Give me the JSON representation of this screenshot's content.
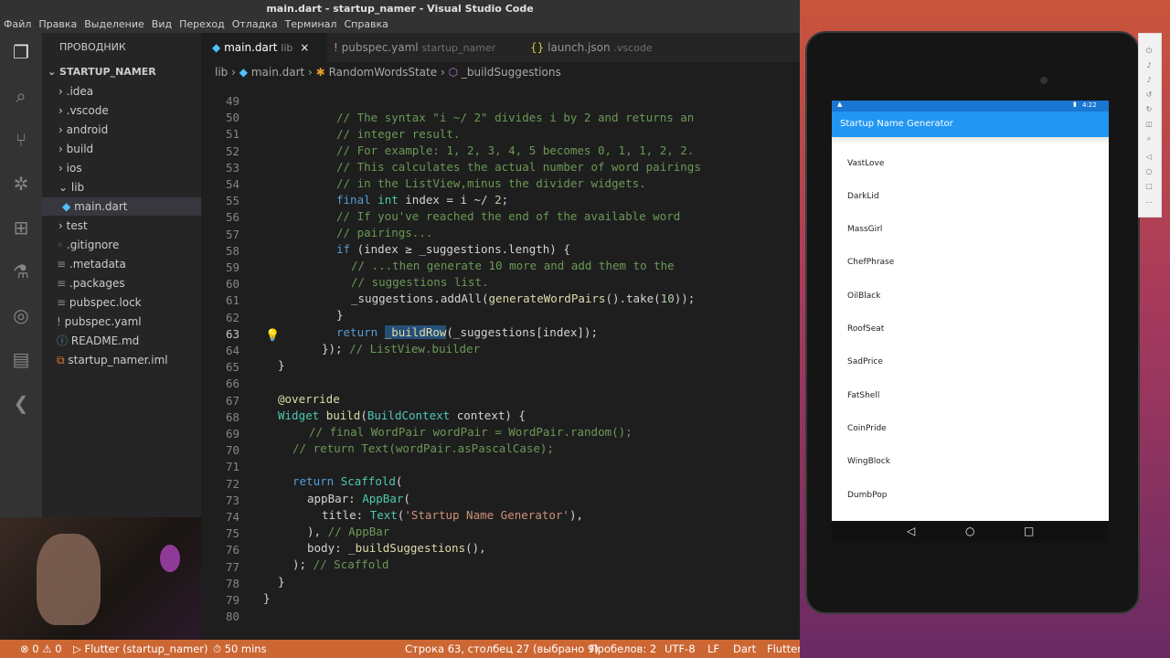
{
  "window": {
    "title": "main.dart - startup_namer - Visual Studio Code"
  },
  "menu": [
    "Файл",
    "Правка",
    "Выделение",
    "Вид",
    "Переход",
    "Отладка",
    "Терминал",
    "Справка"
  ],
  "activity_icons": [
    "explorer-icon",
    "search-icon",
    "source-control-icon",
    "debug-icon",
    "extensions-icon",
    "test-icon",
    "remote-icon",
    "docker-icon",
    "flutter-icon"
  ],
  "sidebar": {
    "header": "ПРОВОДНИК",
    "project": "STARTUP_NAMER",
    "items": [
      {
        "label": ".idea",
        "arrow": "›"
      },
      {
        "label": ".vscode",
        "arrow": "›"
      },
      {
        "label": "android",
        "arrow": "›"
      },
      {
        "label": "build",
        "arrow": "›"
      },
      {
        "label": "ios",
        "arrow": "›"
      },
      {
        "label": "lib",
        "arrow": "⌄"
      },
      {
        "label": "main.dart",
        "arrow": ""
      },
      {
        "label": "test",
        "arrow": "›"
      },
      {
        "label": ".gitignore",
        "arrow": ""
      },
      {
        "label": ".metadata",
        "arrow": ""
      },
      {
        "label": ".packages",
        "arrow": ""
      },
      {
        "label": "pubspec.lock",
        "arrow": ""
      },
      {
        "label": "pubspec.yaml",
        "arrow": ""
      },
      {
        "label": "README.md",
        "arrow": ""
      },
      {
        "label": "startup_namer.iml",
        "arrow": ""
      }
    ]
  },
  "tabs": [
    {
      "name": "main.dart",
      "hint": "lib",
      "close": "×"
    },
    {
      "name": "pubspec.yaml",
      "hint": "startup_namer"
    },
    {
      "name": "launch.json",
      "hint": ".vscode"
    }
  ],
  "breadcrumb": [
    "lib",
    "main.dart",
    "RandomWordsState",
    "_buildSuggestions"
  ],
  "code": {
    "line_numbers": [
      "49",
      "50",
      "51",
      "52",
      "53",
      "54",
      "55",
      "56",
      "57",
      "58",
      "59",
      "60",
      "61",
      "62",
      "63",
      "64",
      "65",
      "66",
      "67",
      "68",
      "69",
      "70",
      "71",
      "72",
      "73",
      "74",
      "75",
      "76",
      "77",
      "78",
      "79",
      "80"
    ],
    "l50": "// The syntax \"i ~/ 2\" divides i by 2 and returns an",
    "l51": "// integer result.",
    "l52": "// For example: 1, 2, 3, 4, 5 becomes 0, 1, 1, 2, 2.",
    "l53": "// This calculates the actual number of word pairings",
    "l54": "// in the ListView,minus the divider widgets.",
    "l55a": "final",
    "l55b": "int",
    "l55c": " index = i ~/ ",
    "l55d": "2",
    "l55e": ";",
    "l56": "// If you've reached the end of the available word",
    "l57": "// pairings...",
    "l58a": "if",
    "l58b": " (index ≥ _suggestions.length) {",
    "l59": "// ...then generate 10 more and add them to the",
    "l60": "// suggestions list.",
    "l61a": "_suggestions.addAll(",
    "l61b": "generateWordPairs",
    "l61c": "().take(",
    "l61d": "10",
    "l61e": "));",
    "l62": "}",
    "l63a": "return",
    "l63b": "_buildRow",
    "l63c": "(_suggestions[index]);",
    "l64a": "});",
    "l64b": "// ListView.builder",
    "l65": "}",
    "l67": "@override",
    "l68a": "Widget",
    "l68b": "build",
    "l68c": "(",
    "l68d": "BuildContext",
    "l68e": " context) {",
    "l69": "// final WordPair wordPair = WordPair.random();",
    "l70": "// return Text(wordPair.asPascalCase);",
    "l72a": "return",
    "l72b": "Scaffold",
    "l72c": "(",
    "l73a": "appBar: ",
    "l73b": "AppBar",
    "l73c": "(",
    "l74a": "title: ",
    "l74b": "Text",
    "l74c": "(",
    "l74d": "'Startup Name Generator'",
    "l74e": "),",
    "l75a": "),",
    "l75b": "// AppBar",
    "l76a": "body: ",
    "l76b": "_buildSuggestions",
    "l76c": "(),",
    "l77a": ");",
    "l77b": "// Scaffold",
    "l78": "}",
    "l79": "}"
  },
  "statusbar": {
    "problems": "⊗ 0 ⚠ 0",
    "debug": "▷ Flutter (startup_namer)",
    "timer": "⏱ 50 mins",
    "position": "Строка 63, столбец 27 (выбрано 9)",
    "spaces": "Пробелов: 2",
    "encoding": "UTF-8",
    "eol": "LF",
    "language": "Dart",
    "flutter": "Flutter"
  },
  "device": {
    "time": "4:22",
    "app_title": "Startup Name Generator",
    "words": [
      "VastLove",
      "DarkLid",
      "MassGirl",
      "ChefPhrase",
      "OilBlack",
      "RoofSeat",
      "SadPrice",
      "FatShell",
      "CoinPride",
      "WingBlock",
      "DumbPop"
    ]
  },
  "colors": {
    "statusbar": "#cc6633",
    "appbar": "#2196f3",
    "editor_bg": "#1e1e1e"
  }
}
